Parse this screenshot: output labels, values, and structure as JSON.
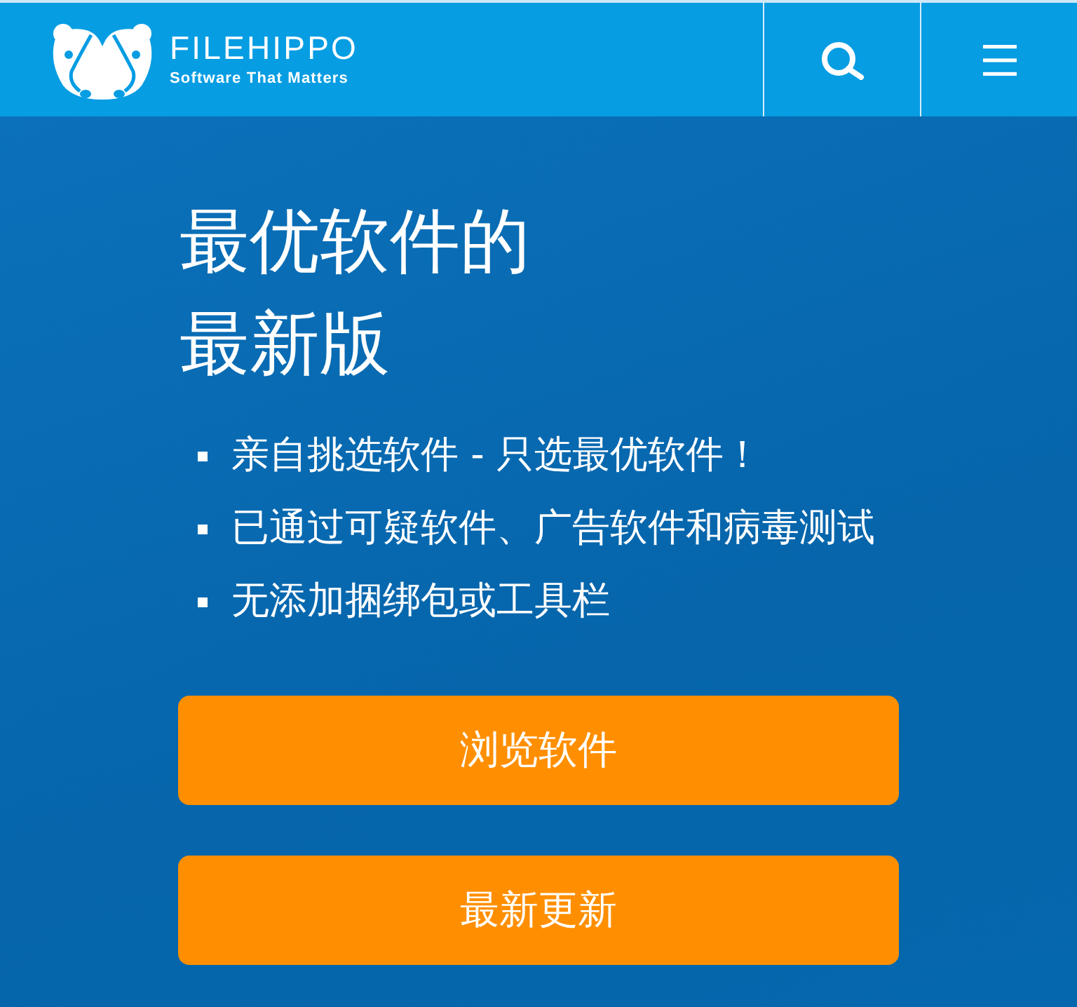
{
  "header": {
    "logo_title": "FILEHIPPO",
    "logo_tagline": "Software That Matters"
  },
  "hero": {
    "heading": "最优软件的最新版",
    "features": [
      "亲自挑选软件 - 只选最优软件！",
      "已通过可疑软件、广告软件和病毒测试",
      "无添加捆绑包或工具栏"
    ],
    "buttons": [
      "浏览软件",
      "最新更新"
    ]
  }
}
